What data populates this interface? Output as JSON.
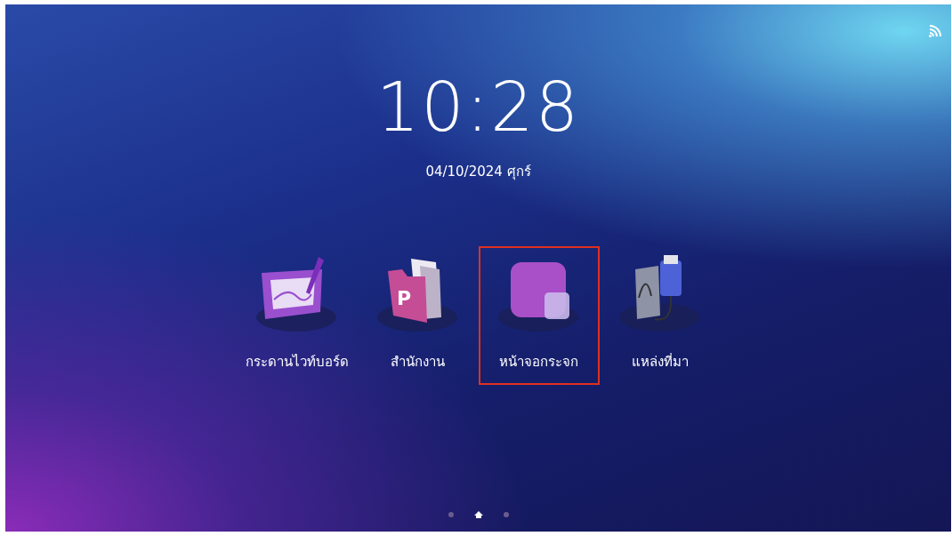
{
  "clock": {
    "time": "10:28",
    "date": "04/10/2024 ศุกร์"
  },
  "status": {
    "cast_on": true
  },
  "apps": [
    {
      "kind": "whiteboard",
      "label": "กระดานไวท์บอร์ด",
      "selected": false
    },
    {
      "kind": "office",
      "label": "สำนักงาน",
      "icon_letter": "P",
      "selected": false
    },
    {
      "kind": "mirror",
      "label": "หน้าจอกระจก",
      "selected": true
    },
    {
      "kind": "source",
      "label": "แหล่งที่มา",
      "selected": false
    }
  ],
  "pages": [
    {
      "kind": "dot",
      "selected": false
    },
    {
      "kind": "home",
      "selected": true
    },
    {
      "kind": "dot",
      "selected": false
    }
  ]
}
